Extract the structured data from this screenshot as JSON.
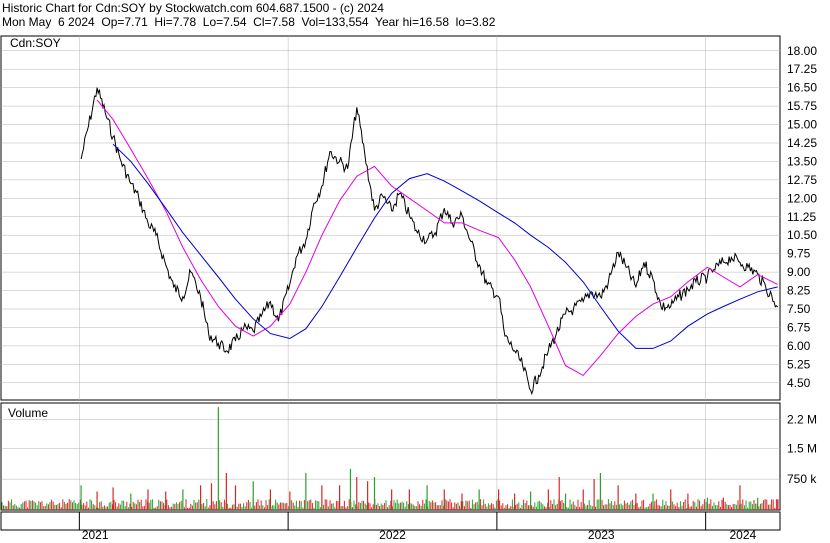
{
  "header": {
    "line1": "Historic Chart for Cdn:SOY by Stockwatch.com 604.687.1500 - (c) 2024",
    "line2": "Mon May  6 2024  Op=7.71  Hi=7.78  Lo=7.54  Cl=7.58  Vol=133,554  Year hi=16.58  lo=3.82"
  },
  "price_panel": {
    "label": "Cdn:SOY"
  },
  "volume_panel": {
    "label": "Volume"
  },
  "colors": {
    "price": "#000000",
    "ma_short": "#e000e0",
    "ma_long": "#0000cc",
    "vol_up": "#2ca02c",
    "vol_down": "#d62728",
    "grid": "#b4b4b4"
  },
  "chart_data": [
    {
      "type": "line",
      "title": "",
      "y_ticks": [
        "18.00",
        "17.25",
        "16.50",
        "15.75",
        "15.00",
        "14.25",
        "13.50",
        "12.75",
        "12.00",
        "11.25",
        "10.50",
        "9.75",
        "9.00",
        "8.25",
        "7.50",
        "6.75",
        "6.00",
        "5.25",
        "4.50"
      ],
      "ylim": [
        3.8,
        18.6
      ],
      "x_ticks": [
        "2021",
        "2022",
        "2023",
        "2024"
      ],
      "series": [
        {
          "name": "",
          "x": [
            "2021-01-04",
            "2021-02-01",
            "2021-02-15",
            "2021-03-01",
            "2021-03-15",
            "2021-04-01",
            "2021-04-15",
            "2021-05-01",
            "2021-05-15",
            "2021-06-01",
            "2021-06-15",
            "2021-07-01",
            "2021-07-15",
            "2021-08-01",
            "2021-08-15",
            "2021-09-01",
            "2021-09-15",
            "2021-10-01",
            "2021-10-15",
            "2021-11-01",
            "2021-11-15",
            "2021-12-01",
            "2021-12-15",
            "2022-01-04",
            "2022-01-15",
            "2022-02-01",
            "2022-02-15",
            "2022-03-01",
            "2022-03-15",
            "2022-04-01",
            "2022-04-15",
            "2022-05-01",
            "2022-05-15",
            "2022-06-01",
            "2022-06-15",
            "2022-07-01",
            "2022-07-15",
            "2022-08-01",
            "2022-08-15",
            "2022-09-01",
            "2022-09-15",
            "2022-10-01",
            "2022-10-15",
            "2022-11-01",
            "2022-11-15",
            "2022-12-01",
            "2022-12-15",
            "2023-01-04",
            "2023-01-15",
            "2023-02-01",
            "2023-02-15",
            "2023-03-01",
            "2023-03-15",
            "2023-04-01",
            "2023-04-15",
            "2023-05-01",
            "2023-05-15",
            "2023-06-01",
            "2023-06-15",
            "2023-07-01",
            "2023-07-15",
            "2023-08-01",
            "2023-08-15",
            "2023-09-01",
            "2023-09-15",
            "2023-10-01",
            "2023-10-15",
            "2023-11-01",
            "2023-11-15",
            "2023-12-01",
            "2023-12-15",
            "2024-01-04",
            "2024-01-15",
            "2024-02-01",
            "2024-02-15",
            "2024-03-01",
            "2024-03-15",
            "2024-04-01",
            "2024-04-15",
            "2024-05-06"
          ],
          "values": [
            13.6,
            16.5,
            15.5,
            14.5,
            13.5,
            12.6,
            12.0,
            11.0,
            10.5,
            9.3,
            8.4,
            8.0,
            9.0,
            8.0,
            6.5,
            6.1,
            5.8,
            6.2,
            6.7,
            6.6,
            7.2,
            7.8,
            7.0,
            8.5,
            9.6,
            10.3,
            11.8,
            12.5,
            13.9,
            13.5,
            13.2,
            15.7,
            13.8,
            11.5,
            12.1,
            11.5,
            12.2,
            11.3,
            10.6,
            10.3,
            10.6,
            11.6,
            11.0,
            11.3,
            10.3,
            9.3,
            8.5,
            8.0,
            6.4,
            5.8,
            5.2,
            4.2,
            4.8,
            5.8,
            6.5,
            7.3,
            7.5,
            7.8,
            8.2,
            8.0,
            8.6,
            9.8,
            9.2,
            8.4,
            9.4,
            8.7,
            7.6,
            7.6,
            8.0,
            8.3,
            8.6,
            8.8,
            9.1,
            9.4,
            9.6,
            9.4,
            9.2,
            8.9,
            8.4,
            7.58
          ]
        },
        {
          "name": "",
          "x": [
            "2021-02-01",
            "2021-03-01",
            "2021-04-01",
            "2021-05-01",
            "2021-06-01",
            "2021-07-01",
            "2021-08-01",
            "2021-09-01",
            "2021-10-01",
            "2021-11-01",
            "2021-12-01",
            "2022-01-04",
            "2022-02-01",
            "2022-03-01",
            "2022-04-01",
            "2022-05-01",
            "2022-06-01",
            "2022-07-01",
            "2022-08-01",
            "2022-09-01",
            "2022-10-01",
            "2022-11-01",
            "2022-12-01",
            "2023-01-04",
            "2023-02-01",
            "2023-03-01",
            "2023-04-01",
            "2023-05-01",
            "2023-06-01",
            "2023-07-01",
            "2023-08-01",
            "2023-09-01",
            "2023-10-01",
            "2023-11-01",
            "2023-12-01",
            "2024-01-04",
            "2024-02-01",
            "2024-03-01",
            "2024-04-01",
            "2024-05-06"
          ],
          "values": [
            16.0,
            15.2,
            14.0,
            12.8,
            11.5,
            10.0,
            8.7,
            7.6,
            6.8,
            6.4,
            6.8,
            7.7,
            9.0,
            10.5,
            11.9,
            12.9,
            13.3,
            12.5,
            12.0,
            11.5,
            11.0,
            11.0,
            10.7,
            10.4,
            9.5,
            8.4,
            6.8,
            5.2,
            4.8,
            5.6,
            6.5,
            7.2,
            7.7,
            8.0,
            8.6,
            9.2,
            8.8,
            8.4,
            8.9,
            8.5
          ]
        },
        {
          "name": "",
          "x": [
            "2021-03-01",
            "2021-04-01",
            "2021-05-01",
            "2021-06-01",
            "2021-07-01",
            "2021-08-01",
            "2021-09-01",
            "2021-10-01",
            "2021-11-01",
            "2021-12-01",
            "2022-01-04",
            "2022-02-01",
            "2022-03-01",
            "2022-04-01",
            "2022-05-01",
            "2022-06-01",
            "2022-07-01",
            "2022-08-01",
            "2022-09-01",
            "2022-10-01",
            "2022-11-01",
            "2022-12-01",
            "2023-01-04",
            "2023-02-01",
            "2023-03-01",
            "2023-04-01",
            "2023-05-01",
            "2023-06-01",
            "2023-07-01",
            "2023-08-01",
            "2023-09-01",
            "2023-10-01",
            "2023-11-01",
            "2023-12-01",
            "2024-01-04",
            "2024-02-01",
            "2024-03-01",
            "2024-04-01",
            "2024-05-06"
          ],
          "values": [
            14.2,
            13.5,
            12.6,
            11.6,
            10.6,
            9.7,
            8.8,
            7.9,
            7.1,
            6.5,
            6.3,
            6.7,
            7.6,
            8.8,
            10.0,
            11.2,
            12.2,
            12.8,
            13.0,
            12.7,
            12.3,
            11.9,
            11.4,
            11.0,
            10.5,
            10.0,
            9.4,
            8.6,
            7.6,
            6.6,
            5.9,
            5.9,
            6.2,
            6.8,
            7.3,
            7.6,
            7.9,
            8.2,
            8.4
          ]
        }
      ]
    },
    {
      "type": "bar",
      "title": "",
      "y_ticks": [
        "2.2 M",
        "1.5 M",
        "750 k"
      ],
      "ylim": [
        0,
        2.6
      ],
      "x": [
        "2021-01-04",
        "2021-02-01",
        "2021-03-01",
        "2021-04-01",
        "2021-05-01",
        "2021-06-01",
        "2021-07-01",
        "2021-08-01",
        "2021-08-20",
        "2021-09-01",
        "2021-09-15",
        "2021-10-01",
        "2021-11-01",
        "2021-12-01",
        "2022-01-04",
        "2022-02-01",
        "2022-03-01",
        "2022-04-01",
        "2022-04-20",
        "2022-05-01",
        "2022-05-20",
        "2022-06-01",
        "2022-07-01",
        "2022-08-01",
        "2022-09-01",
        "2022-10-01",
        "2022-11-01",
        "2022-12-01",
        "2023-01-04",
        "2023-02-01",
        "2023-03-01",
        "2023-04-01",
        "2023-04-20",
        "2023-05-01",
        "2023-06-01",
        "2023-06-20",
        "2023-07-01",
        "2023-08-01",
        "2023-09-01",
        "2023-10-01",
        "2023-11-01",
        "2023-12-01",
        "2024-01-04",
        "2024-02-01",
        "2024-03-01",
        "2024-04-01",
        "2024-05-06"
      ],
      "values": [
        0.6,
        0.45,
        0.55,
        0.4,
        0.5,
        0.45,
        0.5,
        0.6,
        0.65,
        2.5,
        0.9,
        0.6,
        0.7,
        0.5,
        0.45,
        0.9,
        0.6,
        0.6,
        1.0,
        0.8,
        0.7,
        0.8,
        0.5,
        0.5,
        0.6,
        0.5,
        0.4,
        0.5,
        0.5,
        0.4,
        0.45,
        0.5,
        0.8,
        0.4,
        0.5,
        0.75,
        0.9,
        0.6,
        0.4,
        0.4,
        0.5,
        0.4,
        0.3,
        0.3,
        0.6,
        0.3,
        0.25
      ]
    }
  ]
}
